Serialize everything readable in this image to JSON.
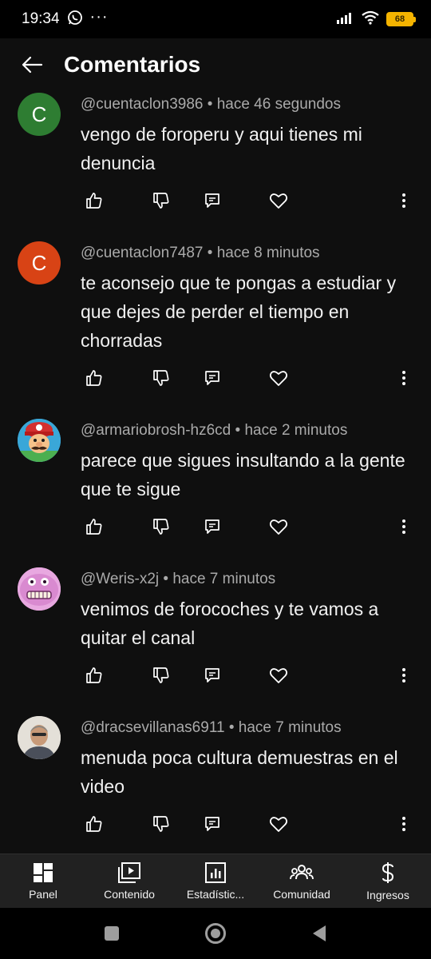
{
  "status_bar": {
    "time": "19:34",
    "battery": "68"
  },
  "header": {
    "title": "Comentarios"
  },
  "comments": [
    {
      "avatar_letter": "C",
      "avatar_color": "#2e7d32",
      "author": "@cuentaclon3986",
      "time": "hace 46 segundos",
      "text": "vengo de foroperu y aqui tienes mi denuncia"
    },
    {
      "avatar_letter": "C",
      "avatar_color": "#d84315",
      "author": "@cuentaclon7487",
      "time": "hace 8 minutos",
      "text": "te aconsejo que te pongas a estudiar y que dejes de perder el tiempo en chorradas"
    },
    {
      "avatar_letter": "",
      "avatar_color": "#3aa7d8",
      "author": "@armariobrosh-hz6cd",
      "time": "hace 2 minutos",
      "text": "parece que sigues insultando a la gente que te sigue"
    },
    {
      "avatar_letter": "",
      "avatar_color": "#e8a8e0",
      "author": "@Weris-x2j",
      "time": "hace 7 minutos",
      "text": "venimos de forocoches y te vamos a quitar el canal"
    },
    {
      "avatar_letter": "",
      "avatar_color": "#d8d4cc",
      "author": "@dracsevillanas6911",
      "time": "hace 7 minutos",
      "text": "menuda poca cultura demuestras en el video"
    }
  ],
  "separator": "•",
  "bottom_nav": {
    "items": [
      {
        "label": "Panel",
        "icon": "dashboard-icon"
      },
      {
        "label": "Contenido",
        "icon": "content-icon"
      },
      {
        "label": "Estadístic...",
        "icon": "analytics-icon"
      },
      {
        "label": "Comunidad",
        "icon": "community-icon"
      },
      {
        "label": "Ingresos",
        "icon": "earn-icon"
      }
    ]
  },
  "colors": {
    "background": "#0f0f0f",
    "text": "#f1f1f1",
    "meta": "#aaaaaa",
    "nav": "#212121"
  }
}
